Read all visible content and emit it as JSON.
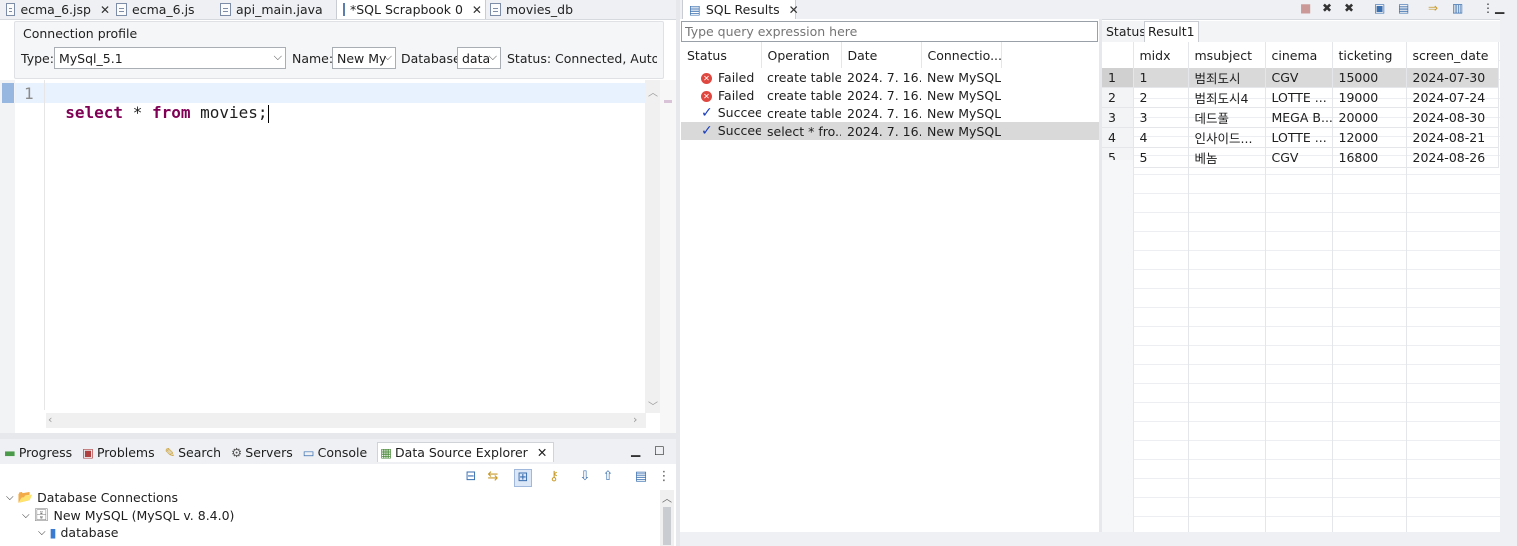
{
  "editor_tabs": [
    {
      "label": "ecma_6.jsp",
      "closable": true
    },
    {
      "label": "ecma_6.js",
      "closable": false
    },
    {
      "label": "api_main.java",
      "closable": false
    },
    {
      "label": "*SQL Scrapbook 0",
      "closable": true
    },
    {
      "label": "movies_db",
      "closable": false
    }
  ],
  "connection": {
    "title": "Connection profile",
    "type_label": "Type:",
    "type_value": "MySql_5.1",
    "name_label": "Name:",
    "name_value": "New My",
    "database_label": "Database:",
    "database_value": "data",
    "status_text": "Status: Connected, Auto Co"
  },
  "editor": {
    "line_number": "1",
    "kw1": "select",
    "mid": " * ",
    "kw2": "from",
    "rest": " movies;"
  },
  "sql_results": {
    "tab_label": "SQL Results",
    "filter_placeholder": "Type query expression here",
    "columns": [
      "Status",
      "Operation",
      "Date",
      "Connectio..."
    ],
    "rows": [
      {
        "status": "Failed",
        "kind": "failed",
        "operation": "create table...",
        "date": "2024. 7. 16...",
        "connection": "New MySQL"
      },
      {
        "status": "Failed",
        "kind": "failed",
        "operation": "create table...",
        "date": "2024. 7. 16...",
        "connection": "New MySQL"
      },
      {
        "status": "Succeed",
        "kind": "ok",
        "operation": "create table...",
        "date": "2024. 7. 16...",
        "connection": "New MySQL"
      },
      {
        "status": "Succeed",
        "kind": "ok",
        "operation": "select * fro...",
        "date": "2024. 7. 16...",
        "connection": "New MySQL"
      }
    ]
  },
  "result_tabs": [
    "Status",
    "Result1"
  ],
  "result_table": {
    "columns": [
      "midx",
      "msubject",
      "cinema",
      "ticketing",
      "screen_date"
    ],
    "rows": [
      [
        "1",
        "1",
        "범죄도시",
        "CGV",
        "15000",
        "2024-07-30"
      ],
      [
        "2",
        "2",
        "범죄도시4",
        "LOTTE ...",
        "19000",
        "2024-07-24"
      ],
      [
        "3",
        "3",
        "데드풀",
        "MEGA B...",
        "20000",
        "2024-08-30"
      ],
      [
        "4",
        "4",
        "인사이드...",
        "LOTTE ...",
        "12000",
        "2024-08-21"
      ],
      [
        "5",
        "5",
        "베놈",
        "CGV",
        "16800",
        "2024-08-26"
      ]
    ]
  },
  "bottom_tabs": [
    {
      "label": "Progress",
      "icon": "progress-icon"
    },
    {
      "label": "Problems",
      "icon": "problems-icon"
    },
    {
      "label": "Search",
      "icon": "search-icon"
    },
    {
      "label": "Servers",
      "icon": "servers-icon"
    },
    {
      "label": "Console",
      "icon": "console-icon"
    },
    {
      "label": "Data Source Explorer",
      "icon": "data-source-icon"
    }
  ],
  "tree": {
    "root": "Database Connections",
    "connection": "New MySQL (MySQL v. 8.4.0)",
    "db": "database"
  }
}
